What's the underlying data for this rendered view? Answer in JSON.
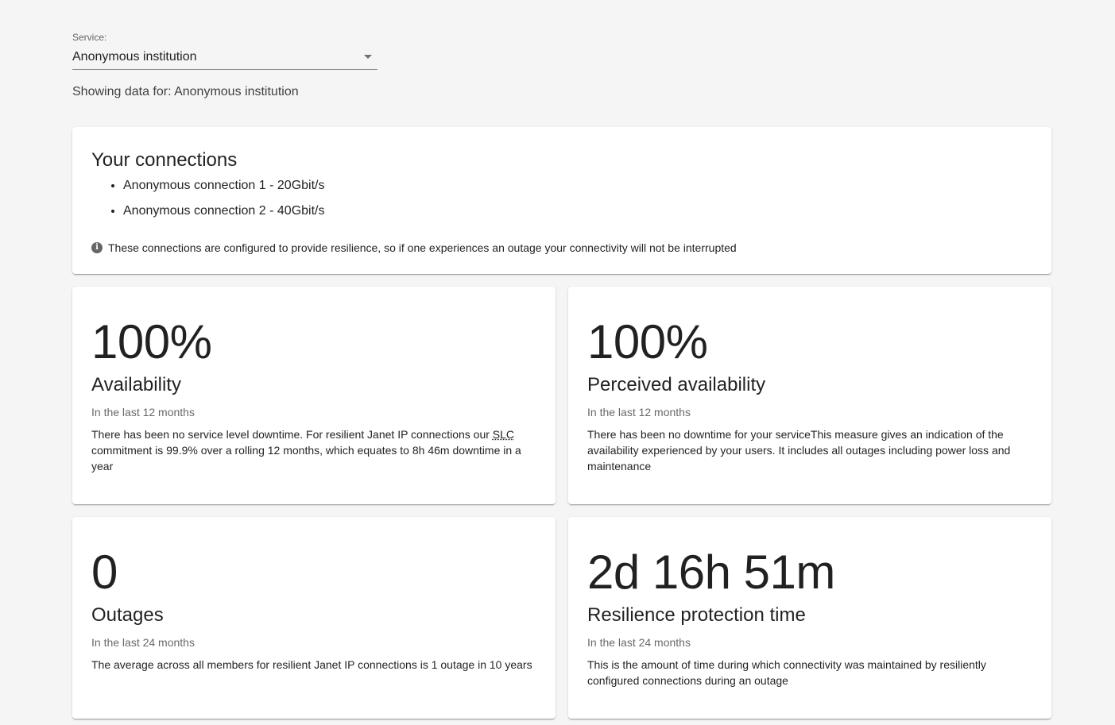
{
  "service": {
    "label": "Service:",
    "value": "Anonymous institution"
  },
  "showing": "Showing data for: Anonymous institution",
  "connections": {
    "title": "Your connections",
    "items": [
      "Anonymous connection 1 - 20Gbit/s",
      "Anonymous connection 2 - 40Gbit/s"
    ],
    "note": "These connections are configured to provide resilience, so if one experiences an outage your connectivity will not be interrupted",
    "note_icon": "info-icon"
  },
  "stats": {
    "availability": {
      "value": "100%",
      "title": "Availability",
      "period": "In the last 12 months",
      "desc_before": "There has been no service level downtime. For resilient Janet IP connections our ",
      "desc_abbr": "SLC",
      "desc_after": " commitment is 99.9% over a rolling 12 months, which equates to 8h 46m downtime in a year"
    },
    "perceived": {
      "value": "100%",
      "title": "Perceived availability",
      "period": "In the last 12 months",
      "desc": "There has been no downtime for your serviceThis measure gives an indication of the availability experienced by your users. It includes all outages including power loss and maintenance"
    },
    "outages": {
      "value": "0",
      "title": "Outages",
      "period": "In the last 24 months",
      "desc": "The average across all members for resilient Janet IP connections is 1 outage in 10 years"
    },
    "resilience": {
      "value": "2d 16h 51m",
      "title": "Resilience protection time",
      "period": "In the last 24 months",
      "desc": "This is the amount of time during which connectivity was maintained by resiliently configured connections during an outage"
    }
  }
}
